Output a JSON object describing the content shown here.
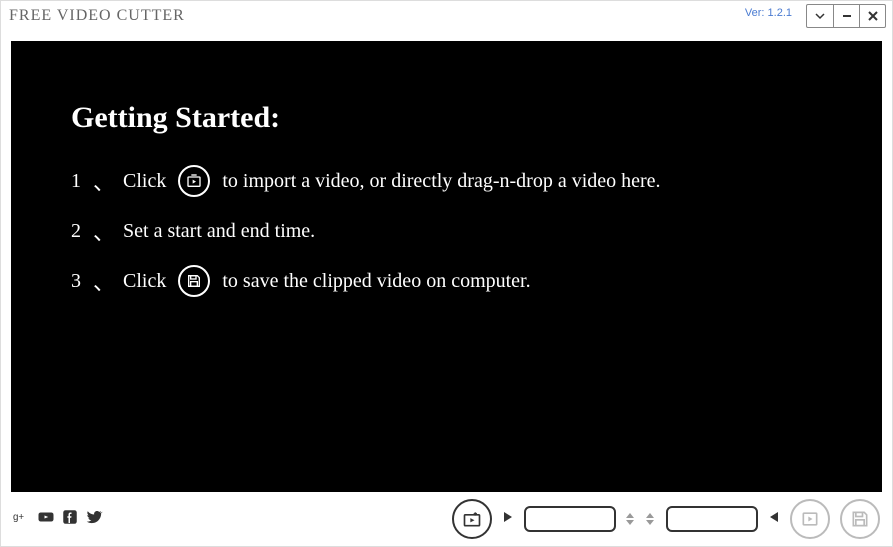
{
  "app": {
    "title": "FREE VIDEO CUTTER",
    "version": "Ver: 1.2.1"
  },
  "guide": {
    "heading": "Getting Started:",
    "step1_num": "1",
    "step1_a": "Click",
    "step1_b": "to import a video, or directly drag-n-drop a video here.",
    "step2_num": "2",
    "step2": "Set a start and end time.",
    "step3_num": "3",
    "step3_a": "Click",
    "step3_b": "to save the clipped video on computer."
  },
  "toolbar": {
    "start_time": "",
    "end_time": ""
  }
}
